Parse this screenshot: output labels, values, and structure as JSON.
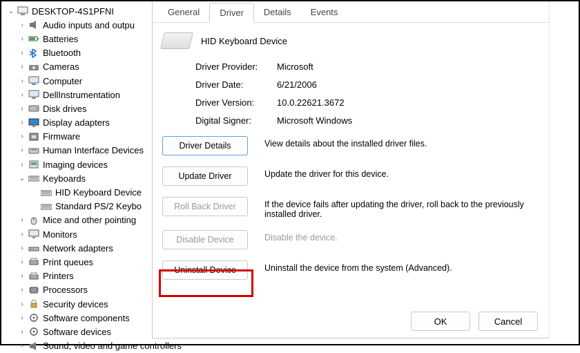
{
  "tree": {
    "root": "DESKTOP-4S1PFNI",
    "items": [
      {
        "label": "Audio inputs and outpu",
        "icon": "audio",
        "expand": "right"
      },
      {
        "label": "Batteries",
        "icon": "battery",
        "expand": "right"
      },
      {
        "label": "Bluetooth",
        "icon": "bluetooth",
        "expand": "right"
      },
      {
        "label": "Cameras",
        "icon": "camera",
        "expand": "right"
      },
      {
        "label": "Computer",
        "icon": "computer",
        "expand": "right"
      },
      {
        "label": "DellInstrumentation",
        "icon": "computer",
        "expand": "right"
      },
      {
        "label": "Disk drives",
        "icon": "disk",
        "expand": "right"
      },
      {
        "label": "Display adapters",
        "icon": "display",
        "expand": "right"
      },
      {
        "label": "Firmware",
        "icon": "firmware",
        "expand": "right"
      },
      {
        "label": "Human Interface Devices",
        "icon": "hid",
        "expand": "right"
      },
      {
        "label": "Imaging devices",
        "icon": "imaging",
        "expand": "right"
      },
      {
        "label": "Keyboards",
        "icon": "keyboard",
        "expand": "down"
      },
      {
        "label": "Mice and other pointing",
        "icon": "mouse",
        "expand": "right"
      },
      {
        "label": "Monitors",
        "icon": "monitor",
        "expand": "right"
      },
      {
        "label": "Network adapters",
        "icon": "network",
        "expand": "right"
      },
      {
        "label": "Print queues",
        "icon": "printer",
        "expand": "right"
      },
      {
        "label": "Printers",
        "icon": "printer",
        "expand": "right"
      },
      {
        "label": "Processors",
        "icon": "cpu",
        "expand": "right"
      },
      {
        "label": "Security devices",
        "icon": "security",
        "expand": "right"
      },
      {
        "label": "Software components",
        "icon": "software",
        "expand": "right"
      },
      {
        "label": "Software devices",
        "icon": "software",
        "expand": "right"
      },
      {
        "label": "Sound, video and game controllers",
        "icon": "audio",
        "expand": "right"
      }
    ],
    "kb_children": [
      "HID Keyboard Device",
      "Standard PS/2 Keybo"
    ]
  },
  "dialog": {
    "tabs": [
      "General",
      "Driver",
      "Details",
      "Events"
    ],
    "active_tab": 1,
    "device_name": "HID Keyboard Device",
    "info": {
      "provider_label": "Driver Provider:",
      "provider_value": "Microsoft",
      "date_label": "Driver Date:",
      "date_value": "6/21/2006",
      "version_label": "Driver Version:",
      "version_value": "10.0.22621.3672",
      "signer_label": "Digital Signer:",
      "signer_value": "Microsoft Windows"
    },
    "actions": {
      "details_btn": "Driver Details",
      "details_desc": "View details about the installed driver files.",
      "update_btn": "Update Driver",
      "update_desc": "Update the driver for this device.",
      "rollback_btn": "Roll Back Driver",
      "rollback_desc": "If the device fails after updating the driver, roll back to the previously installed driver.",
      "disable_btn": "Disable Device",
      "disable_desc": "Disable the device.",
      "uninstall_btn": "Uninstall Device",
      "uninstall_desc": "Uninstall the device from the system (Advanced)."
    },
    "ok": "OK",
    "cancel": "Cancel"
  }
}
